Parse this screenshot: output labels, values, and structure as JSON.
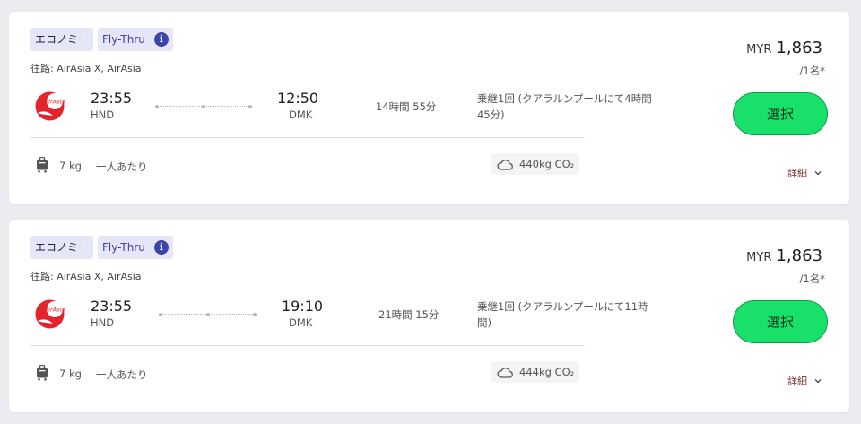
{
  "results": [
    {
      "cabin_badge": "エコノミー",
      "flythru_badge": "Fly-Thru",
      "info_icon_glyph": "i",
      "route": "往路: AirAsia X, AirAsia",
      "airline_logo": "airasia-logo",
      "departure": {
        "time": "23:55",
        "code": "HND"
      },
      "arrival": {
        "time": "12:50",
        "code": "DMK"
      },
      "duration": "14時間 55分",
      "transfer": "乗継1回 (クアラルンプールにて4時間 45分)",
      "baggage_weight": "7 kg",
      "baggage_per": "一人あたり",
      "co2": "440kg CO₂",
      "currency": "MYR",
      "price": "1,863",
      "per_person": "/1名*",
      "select_label": "選択",
      "details_label": "詳細"
    },
    {
      "cabin_badge": "エコノミー",
      "flythru_badge": "Fly-Thru",
      "info_icon_glyph": "i",
      "route": "往路: AirAsia X, AirAsia",
      "airline_logo": "airasia-logo",
      "departure": {
        "time": "23:55",
        "code": "HND"
      },
      "arrival": {
        "time": "19:10",
        "code": "DMK"
      },
      "duration": "21時間 15分",
      "transfer": "乗継1回 (クアラルンプールにて11時間)",
      "baggage_weight": "7 kg",
      "baggage_per": "一人あたり",
      "co2": "444kg CO₂",
      "currency": "MYR",
      "price": "1,863",
      "per_person": "/1名*",
      "select_label": "選択",
      "details_label": "詳細"
    }
  ],
  "colors": {
    "page_background": "#ebecf0",
    "badge_background": "#e5e6f7",
    "info_icon": "#3e44a9",
    "select_button": "#19e068",
    "details_text": "#7a2a2a",
    "brand_red": "#e3242b"
  }
}
